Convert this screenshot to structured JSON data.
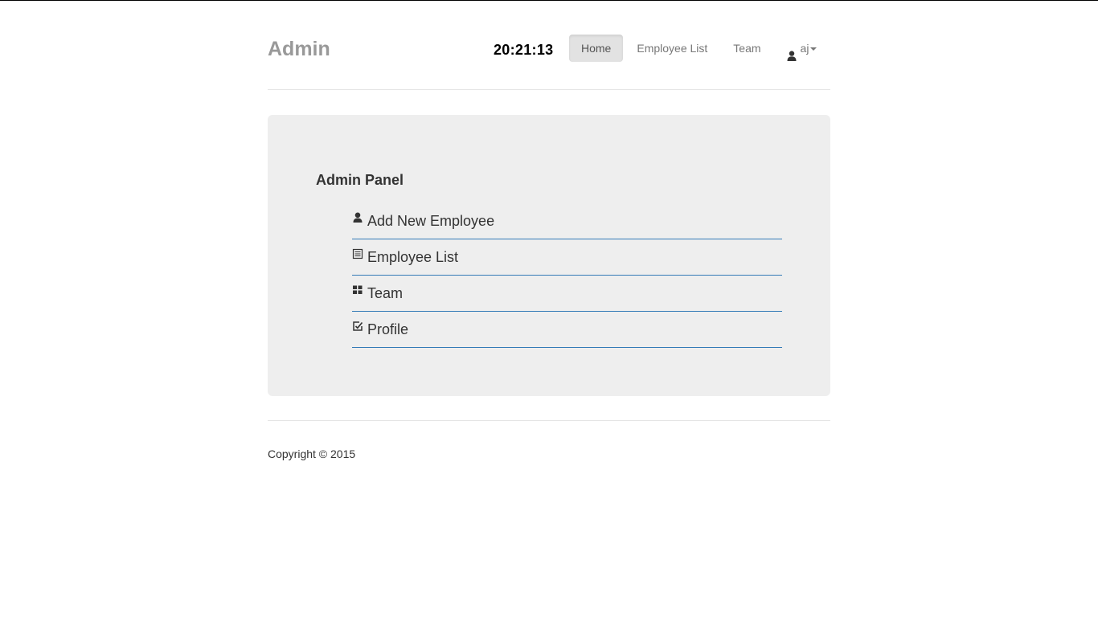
{
  "header": {
    "brand": "Admin",
    "clock": "20:21:13",
    "nav": {
      "home": "Home",
      "employee_list": "Employee List",
      "team": "Team",
      "user": "aj"
    }
  },
  "panel": {
    "title": "Admin Panel",
    "items": [
      {
        "label": "Add New Employee",
        "icon": "user-icon"
      },
      {
        "label": "Employee List",
        "icon": "list-icon"
      },
      {
        "label": "Team",
        "icon": "grid-icon"
      },
      {
        "label": "Profile",
        "icon": "edit-icon"
      }
    ]
  },
  "footer": {
    "copyright": "Copyright © 2015"
  },
  "colors": {
    "accent_line": "#337ab7",
    "jumbotron_bg": "#eeeeee",
    "brand": "#999999",
    "active_nav_bg": "#e2e2e2"
  }
}
